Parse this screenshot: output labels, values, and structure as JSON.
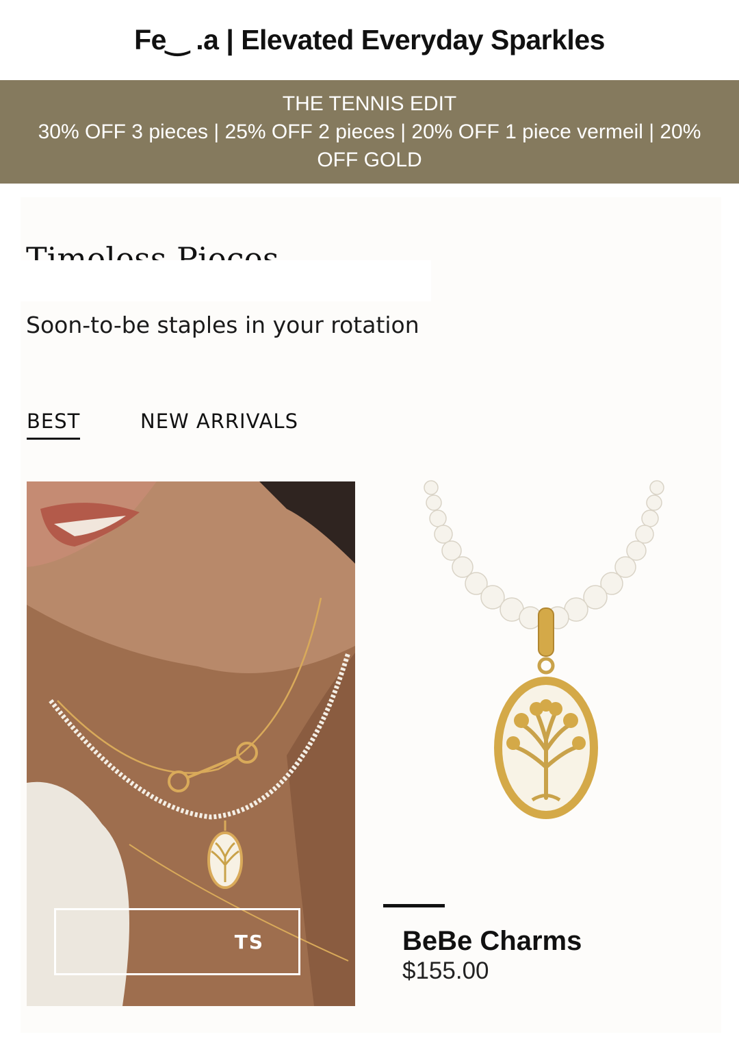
{
  "header": {
    "title": "Fe‿  .a | Elevated Everyday Sparkles"
  },
  "promo": {
    "line1": "THE TENNIS EDIT",
    "line2": "30% OFF 3 pieces | 25% OFF 2 pieces | 20% OFF 1 piece vermeil | 20%",
    "line3": "OFF GOLD"
  },
  "section": {
    "title": "Timeless Pieces",
    "subtitle": "Soon-to-be staples in your rotation"
  },
  "tabs": [
    {
      "label": "BEST",
      "active": true
    },
    {
      "label": "NEW ARRIVALS",
      "active": false
    }
  ],
  "lifestyle": {
    "button_label": "TS"
  },
  "product": {
    "name": "BeBe Charms",
    "price": "$155.00"
  },
  "colors": {
    "promo_bg": "#857a5e",
    "gold": "#c9a24a"
  }
}
